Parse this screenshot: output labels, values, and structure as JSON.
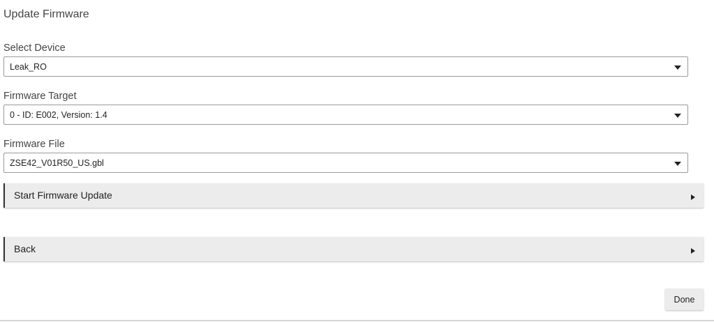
{
  "dialog": {
    "title": "Update Firmware"
  },
  "fields": {
    "device": {
      "label": "Select Device",
      "value": "Leak_RO"
    },
    "target": {
      "label": "Firmware Target",
      "value": "0 - ID: E002, Version: 1.4"
    },
    "file": {
      "label": "Firmware File",
      "value": "ZSE42_V01R50_US.gbl"
    }
  },
  "actions": {
    "start_label": "Start Firmware Update",
    "back_label": "Back",
    "done_label": "Done"
  },
  "icons": {
    "select_arrow": "caret-down-icon",
    "action_arrow": "play-icon"
  },
  "colors": {
    "button_bg": "#ececec",
    "border": "#9a9a9a",
    "accent_bar": "#333333"
  }
}
